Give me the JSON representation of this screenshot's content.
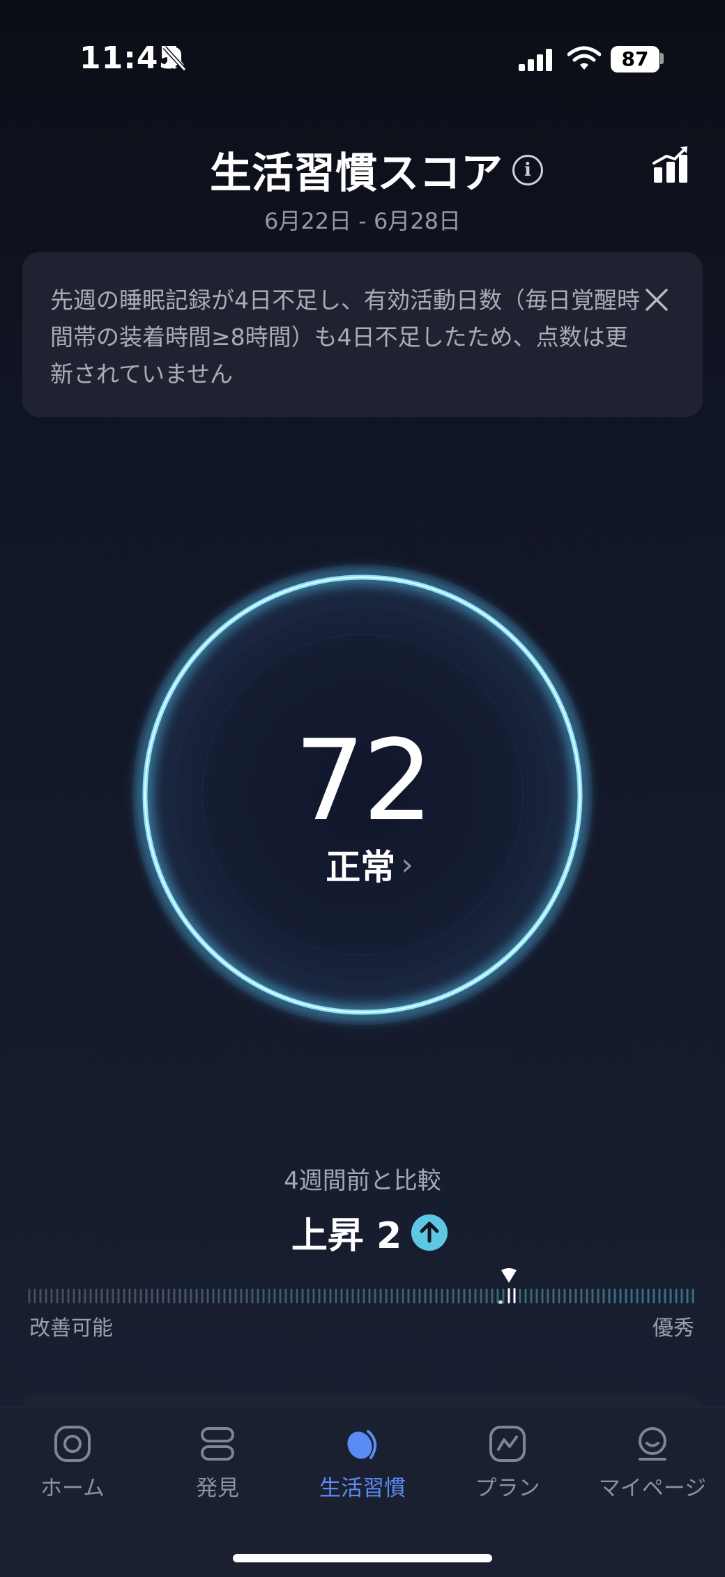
{
  "status_bar": {
    "time": "11:45",
    "battery": "87"
  },
  "header": {
    "title": "生活習慣スコア",
    "date_range": "6月22日 - 6月28日"
  },
  "notice": {
    "text": "先週の睡眠記録が4日不足し、有効活動日数（毎日覚醒時間帯の装着時間≥8時間）も4日不足したため、点数は更新されていません"
  },
  "score": {
    "value": "72",
    "status": "正常"
  },
  "comparison": {
    "label": "4週間前と比較",
    "change_text": "上昇 2",
    "scale_low": "改善可能",
    "scale_high": "優秀",
    "score_fraction": 0.72
  },
  "tabs": [
    {
      "label": "ホーム",
      "icon": "home-icon",
      "active": false
    },
    {
      "label": "発見",
      "icon": "discover-icon",
      "active": false
    },
    {
      "label": "生活習慣",
      "icon": "lifestyle-icon",
      "active": true
    },
    {
      "label": "プラン",
      "icon": "plan-icon",
      "active": false
    },
    {
      "label": "マイページ",
      "icon": "mypage-icon",
      "active": false
    }
  ],
  "colors": {
    "accent": "#5b8cf5",
    "ring": "#7fd8f0",
    "up_badge": "#5ec7e4"
  }
}
